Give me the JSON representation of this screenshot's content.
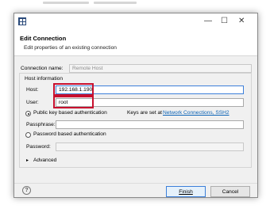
{
  "dialog": {
    "window_controls": {
      "minimize": "—",
      "maximize": "☐",
      "close": "✕"
    },
    "title": "Edit Connection",
    "subtitle": "Edit properties of an existing connection",
    "connection_name_label": "Connection name:",
    "connection_name_value": "Remote Host",
    "host_information_label": "Host information",
    "host_label": "Host:",
    "host_value": "192.168.1.190",
    "user_label": "User:",
    "user_value": "root",
    "pubkey_label": "Public key based authentication",
    "keys_set_at_label": "Keys are set at",
    "keys_link": "Network Connections, SSH2",
    "passphrase_label": "Passphrase:",
    "password_auth_label": "Password based authentication",
    "password_label": "Password:",
    "advanced_label": "Advanced",
    "help_glyph": "?",
    "finish_label": "Finish",
    "cancel_label": "Cancel"
  },
  "colors": {
    "highlight": "#c8102e",
    "link": "#0b63b6",
    "focus_border": "#3c7fd9"
  }
}
